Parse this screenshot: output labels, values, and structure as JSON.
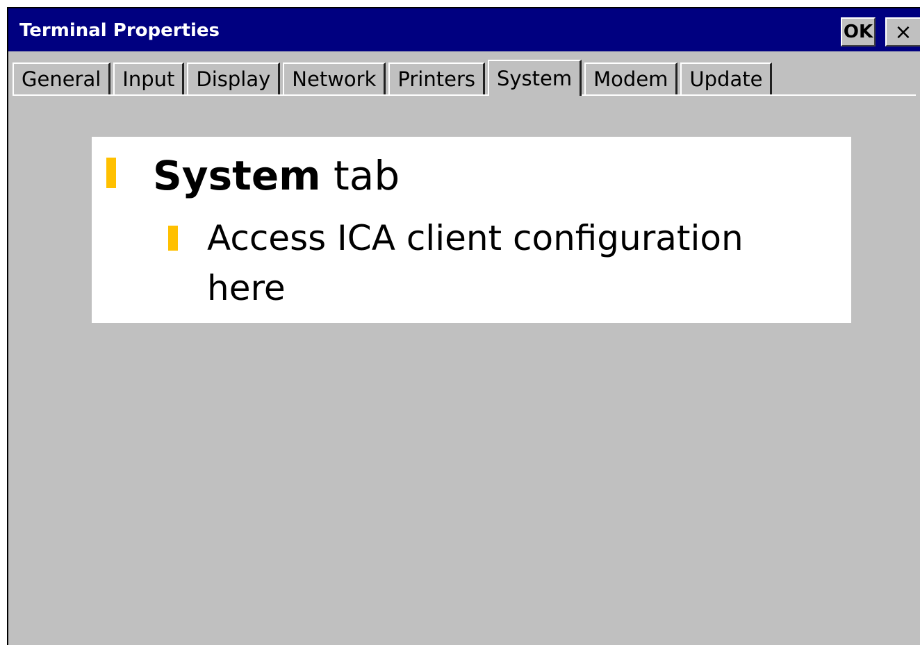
{
  "window": {
    "title": "Terminal Properties",
    "ok_label": "OK",
    "close_label": "×"
  },
  "tabs": [
    {
      "label": "General",
      "active": false
    },
    {
      "label": "Input",
      "active": false
    },
    {
      "label": "Display",
      "active": false
    },
    {
      "label": "Network",
      "active": false
    },
    {
      "label": "Printers",
      "active": false
    },
    {
      "label": "System",
      "active": true
    },
    {
      "label": "Modem",
      "active": false
    },
    {
      "label": "Update",
      "active": false
    }
  ],
  "overlay": {
    "heading_bold": "System",
    "heading_rest": " tab",
    "sub_bullet": "Access ICA client configuration here"
  },
  "colors": {
    "titlebar": "#000080",
    "dialog": "#c0c0c0",
    "bullet": "#ffc000"
  }
}
